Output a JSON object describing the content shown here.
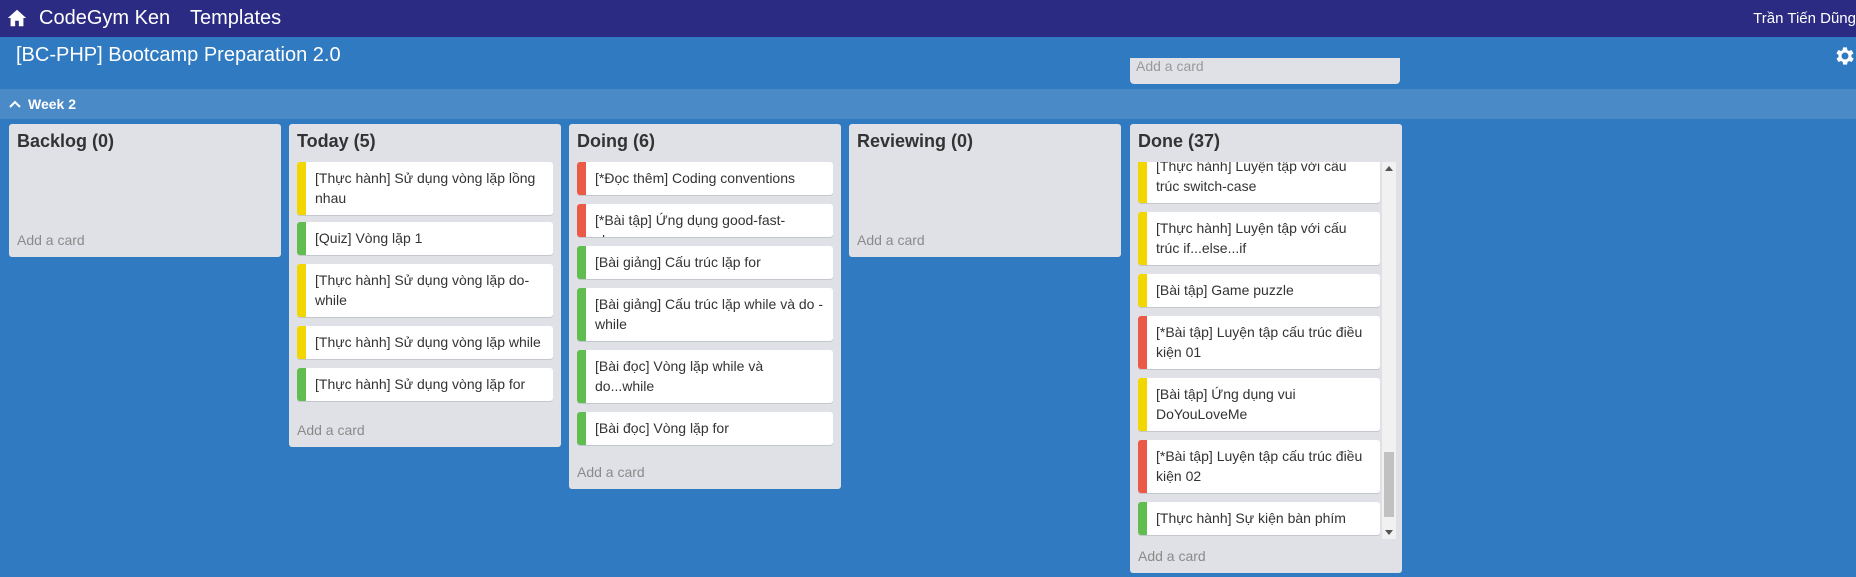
{
  "topbar": {
    "org_name": "CodeGym Ken",
    "templates_label": "Templates",
    "user_name": "Trần Tiến Dũng"
  },
  "board": {
    "title": "[BC-PHP] Bootcamp Preparation 2.0"
  },
  "stub_card": {
    "label": "Add a card"
  },
  "swimlane": {
    "title": "Week 2"
  },
  "colors": {
    "yellow": "#f2d600",
    "green": "#61bd4f",
    "red": "#eb5a46",
    "board_bg": "#2f7ac0",
    "topbar_bg": "#2b2b83"
  },
  "lists": [
    {
      "title": "Backlog (0)",
      "add_label": "Add a card",
      "cards": []
    },
    {
      "title": "Today (5)",
      "add_label": "Add a card",
      "cards": [
        {
          "text": "[Thực hành] Sử dụng vòng lặp lồng nhau",
          "label": "yellow"
        },
        {
          "text": "[Quiz] Vòng lặp 1",
          "label": "green"
        },
        {
          "text": "[Thực hành] Sử dụng vòng lặp do-while",
          "label": "yellow"
        },
        {
          "text": "[Thực hành] Sử dụng vòng lặp while",
          "label": "yellow"
        },
        {
          "text": "[Thực hành] Sử dụng vòng lặp for",
          "label": "green"
        }
      ]
    },
    {
      "title": "Doing (6)",
      "add_label": "Add a card",
      "cards": [
        {
          "text": "[*Đọc thêm] Coding conventions",
          "label": "red"
        },
        {
          "text": "[*Bài tập] Ứng dụng good-fast-cheap",
          "label": "red"
        },
        {
          "text": "[Bài giảng] Cấu trúc lặp for",
          "label": "green"
        },
        {
          "text": "[Bài giảng] Cấu trúc lặp while và do - while",
          "label": "green"
        },
        {
          "text": "[Bài đọc] Vòng lặp while và do...while",
          "label": "green"
        },
        {
          "text": "[Bài đọc] Vòng lặp for",
          "label": "green"
        }
      ]
    },
    {
      "title": "Reviewing (0)",
      "add_label": "Add a card",
      "cards": []
    },
    {
      "title": "Done (37)",
      "add_label": "Add a card",
      "cards": [
        {
          "text": "[Thực hành] Luyện tập với cấu trúc switch-case",
          "label": "yellow"
        },
        {
          "text": "[Thực hành] Luyện tập với cấu trúc if...else...if",
          "label": "yellow"
        },
        {
          "text": "[Bài tập] Game puzzle",
          "label": "yellow"
        },
        {
          "text": "[*Bài tập] Luyện tập cấu trúc điều kiện 01",
          "label": "red"
        },
        {
          "text": "[Bài tập] Ứng dụng vui DoYouLoveMe",
          "label": "yellow"
        },
        {
          "text": "[*Bài tập] Luyện tập cấu trúc điều kiện 02",
          "label": "red"
        },
        {
          "text": "[Thực hành] Sự kiện bàn phím",
          "label": "green"
        }
      ]
    }
  ]
}
